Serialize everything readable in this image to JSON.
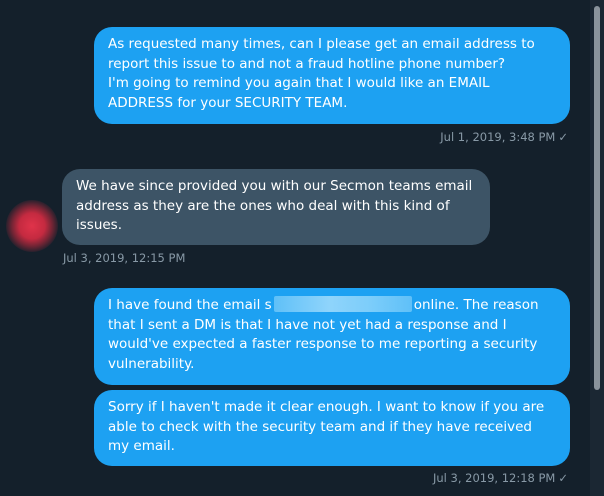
{
  "messages": [
    {
      "text": "As requested many times, can I please get an email address to report this issue to and not a fraud hotline phone number?\nI'm going to remind you again that I would like an EMAIL ADDRESS for your SECURITY TEAM.",
      "timestamp": "Jul 1, 2019, 3:48 PM"
    },
    {
      "text": "We have since provided you with our Secmon teams email address as they are the ones who deal with this kind of issues.",
      "timestamp": "Jul 3, 2019, 12:15 PM"
    },
    {
      "text_before": "I have found the email s",
      "text_after": "online. The reason that I sent a DM is that I have not yet had a response and I would've expected a faster response to me reporting a security vulnerability."
    },
    {
      "text": "Sorry if I haven't made it clear enough. I want to know if you are able to check with the security team and if they have received my email.",
      "timestamp": "Jul 3, 2019, 12:18 PM"
    }
  ],
  "check_glyph": "✓"
}
